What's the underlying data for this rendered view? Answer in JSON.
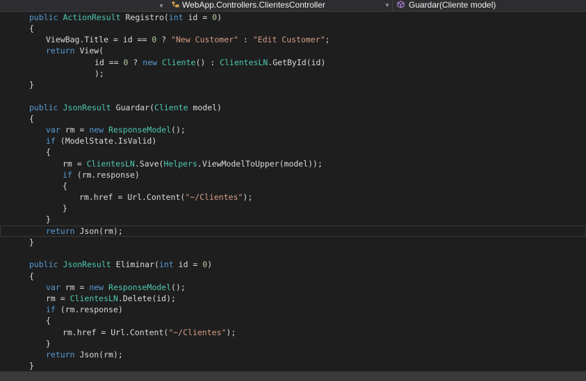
{
  "nav_bar": {
    "class_path": "WebApp.Controllers.ClientesController",
    "member": "Guardar(Cliente model)",
    "class_icon": "class-icon",
    "member_icon": "method-cube-icon"
  },
  "editor": {
    "current_line": 19,
    "lines": [
      [
        [
          "kw",
          "public "
        ],
        [
          "ty",
          "ActionResult "
        ],
        [
          "id",
          "Registro("
        ],
        [
          "kw",
          "int "
        ],
        [
          "id",
          "id = "
        ],
        [
          "nu",
          "0"
        ],
        [
          "id",
          ")"
        ]
      ],
      [
        [
          "id",
          "{"
        ]
      ],
      [
        [
          "id",
          "ViewBag.Title = id == "
        ],
        [
          "nu",
          "0"
        ],
        [
          "id",
          " ? "
        ],
        [
          "st",
          "\"New Customer\""
        ],
        [
          "id",
          " : "
        ],
        [
          "st",
          "\"Edit Customer\""
        ],
        [
          "id",
          ";"
        ]
      ],
      [
        [
          "kw",
          "return "
        ],
        [
          "id",
          "View("
        ]
      ],
      [
        [
          "id",
          "id == "
        ],
        [
          "nu",
          "0"
        ],
        [
          "id",
          " ? "
        ],
        [
          "kw",
          "new "
        ],
        [
          "ty",
          "Cliente"
        ],
        [
          "id",
          "() : "
        ],
        [
          "ty",
          "ClientesLN"
        ],
        [
          "id",
          ".GetById(id)"
        ]
      ],
      [
        [
          "id",
          ");"
        ]
      ],
      [
        [
          "id",
          "}"
        ]
      ],
      [],
      [
        [
          "kw",
          "public "
        ],
        [
          "ty",
          "JsonResult "
        ],
        [
          "id",
          "Guardar("
        ],
        [
          "ty",
          "Cliente "
        ],
        [
          "id",
          "model)"
        ]
      ],
      [
        [
          "id",
          "{"
        ]
      ],
      [
        [
          "kw",
          "var "
        ],
        [
          "id",
          "rm = "
        ],
        [
          "kw",
          "new "
        ],
        [
          "ty",
          "ResponseModel"
        ],
        [
          "id",
          "();"
        ]
      ],
      [
        [
          "kw",
          "if "
        ],
        [
          "id",
          "(ModelState.IsValid)"
        ]
      ],
      [
        [
          "id",
          "{"
        ]
      ],
      [
        [
          "id",
          "rm = "
        ],
        [
          "ty",
          "ClientesLN"
        ],
        [
          "id",
          ".Save("
        ],
        [
          "ty",
          "Helpers"
        ],
        [
          "id",
          ".ViewModelToUpper(model));"
        ]
      ],
      [
        [
          "kw",
          "if "
        ],
        [
          "id",
          "(rm.response)"
        ]
      ],
      [
        [
          "id",
          "{"
        ]
      ],
      [
        [
          "id",
          "rm.href = Url.Content("
        ],
        [
          "st",
          "\"~/Clientes\""
        ],
        [
          "id",
          ");"
        ]
      ],
      [
        [
          "id",
          "}"
        ]
      ],
      [
        [
          "id",
          "}"
        ]
      ],
      [
        [
          "kw",
          "return "
        ],
        [
          "id",
          "Json(rm);"
        ]
      ],
      [
        [
          "id",
          "}"
        ]
      ],
      [],
      [
        [
          "kw",
          "public "
        ],
        [
          "ty",
          "JsonResult "
        ],
        [
          "id",
          "Eliminar("
        ],
        [
          "kw",
          "int "
        ],
        [
          "id",
          "id = "
        ],
        [
          "nu",
          "0"
        ],
        [
          "id",
          ")"
        ]
      ],
      [
        [
          "id",
          "{"
        ]
      ],
      [
        [
          "kw",
          "var "
        ],
        [
          "id",
          "rm = "
        ],
        [
          "kw",
          "new "
        ],
        [
          "ty",
          "ResponseModel"
        ],
        [
          "id",
          "();"
        ]
      ],
      [
        [
          "id",
          "rm = "
        ],
        [
          "ty",
          "ClientesLN"
        ],
        [
          "id",
          ".Delete(id);"
        ]
      ],
      [
        [
          "kw",
          "if "
        ],
        [
          "id",
          "(rm.response)"
        ]
      ],
      [
        [
          "id",
          "{"
        ]
      ],
      [
        [
          "id",
          "rm.href = Url.Content("
        ],
        [
          "st",
          "\"~/Clientes\""
        ],
        [
          "id",
          ");"
        ]
      ],
      [
        [
          "id",
          "}"
        ]
      ],
      [
        [
          "kw",
          "return "
        ],
        [
          "id",
          "Json(rm);"
        ]
      ],
      [
        [
          "id",
          "}"
        ]
      ]
    ]
  }
}
